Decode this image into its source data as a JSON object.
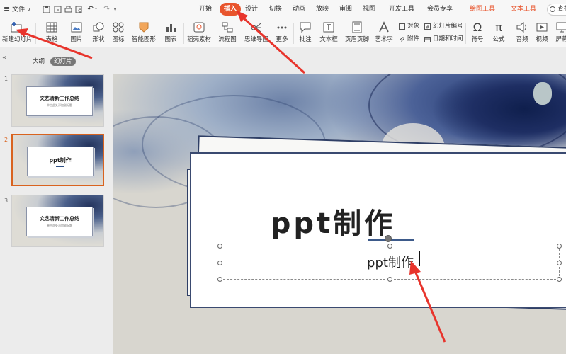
{
  "topbar": {
    "file_menu": "文件",
    "tabs": [
      {
        "label": "开始"
      },
      {
        "label": "插入"
      },
      {
        "label": "设计"
      },
      {
        "label": "切换"
      },
      {
        "label": "动画"
      },
      {
        "label": "放映"
      },
      {
        "label": "审阅"
      },
      {
        "label": "视图"
      },
      {
        "label": "开发工具"
      },
      {
        "label": "会员专享"
      },
      {
        "label": "绘图工具"
      },
      {
        "label": "文本工具"
      }
    ],
    "search": "查找"
  },
  "ribbon": {
    "new_slide": "新建幻灯片",
    "table": "表格",
    "picture": "图片",
    "shape": "形状",
    "icon": "图标",
    "smartart": "智能图形",
    "chart": "图表",
    "material": "稻壳素材",
    "flowchart": "流程图",
    "mindmap": "思维导图",
    "more": "更多",
    "comment": "批注",
    "textbox": "文本框",
    "header_footer": "页眉页脚",
    "wordart": "艺术字",
    "object": "对象",
    "slide_number": "幻灯片编号",
    "attachment": "附件",
    "datetime": "日期和时间",
    "symbol": "符号",
    "formula": "公式",
    "audio": "音频",
    "video": "视频",
    "screen": "屏幕"
  },
  "pane": {
    "outline_tab": "大纲",
    "slides_tab": "幻灯片",
    "slides": [
      {
        "num": "1",
        "title": "文艺清新工作总结",
        "subtitle": "单击此处添加副标题"
      },
      {
        "num": "2",
        "title": "ppt制作",
        "subtitle": ""
      },
      {
        "num": "3",
        "title": "文艺清新工作总结",
        "subtitle": "单击此处添加副标题"
      }
    ]
  },
  "slide": {
    "title": "ppt制作",
    "subtitle": "ppt制作"
  },
  "colors": {
    "accent": "#e8542c",
    "selection": "#d9631f",
    "arrow": "#e8342c",
    "slide_navy": "#1e2e63"
  }
}
